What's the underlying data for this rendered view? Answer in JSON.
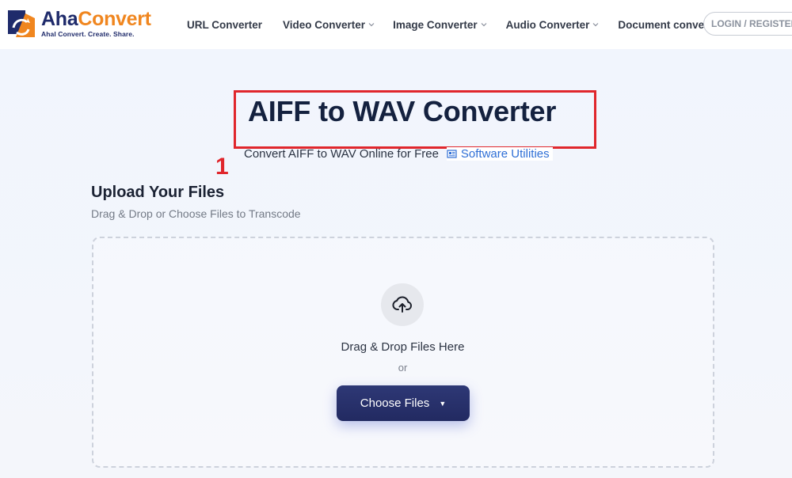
{
  "header": {
    "logo": {
      "name_part1": "Aha",
      "name_part2": "Convert",
      "tagline": "Ahal Convert. Create. Share."
    },
    "nav": [
      {
        "label": "URL Converter",
        "has_dropdown": false
      },
      {
        "label": "Video Converter",
        "has_dropdown": true
      },
      {
        "label": "Image Converter",
        "has_dropdown": true
      },
      {
        "label": "Audio Converter",
        "has_dropdown": true
      },
      {
        "label": "Document converter",
        "has_dropdown": false
      }
    ],
    "login_label": "LOGIN / REGISTER"
  },
  "hero": {
    "title": "AIFF to WAV Converter",
    "subtitle": "Convert AIFF to WAV Online for Free",
    "software_link": "Software Utilities",
    "annotation_marker": "1"
  },
  "upload": {
    "title": "Upload Your Files",
    "subtitle": "Drag & Drop or Choose Files to Transcode",
    "drag_text": "Drag & Drop Files Here",
    "or_text": "or",
    "choose_label": "Choose Files",
    "choose_caret": "▼"
  },
  "colors": {
    "brand_navy": "#1f2b6b",
    "brand_orange": "#f0861f",
    "annotation_red": "#e0262c",
    "link_blue": "#2f6fd6",
    "button_navy": "#222a61"
  },
  "icons": {
    "logo": "aha-logo-icon",
    "chevron": "chevron-down-icon",
    "software": "newspaper-icon",
    "upload": "cloud-upload-icon"
  }
}
